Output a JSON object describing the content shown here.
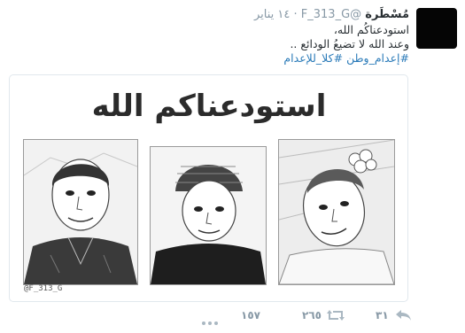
{
  "tweet": {
    "display_name": "مُسْطَرة",
    "handle": "@F_313_G",
    "separator": "·",
    "timestamp": "١٤ يناير",
    "lines": [
      "استودعناكُم الله،",
      "وعند الله لا تضيعُ الودائع .."
    ],
    "hashtags": [
      "#إعدام_وطن",
      "#كلا_للإعدام"
    ]
  },
  "media": {
    "calligraphy_text": "استودعناكم الله",
    "watermark": "@F_313_G"
  },
  "actions": {
    "reply_count": "٣١",
    "retweet_count": "٢٦٥",
    "favorite_count": "١٥٧"
  }
}
